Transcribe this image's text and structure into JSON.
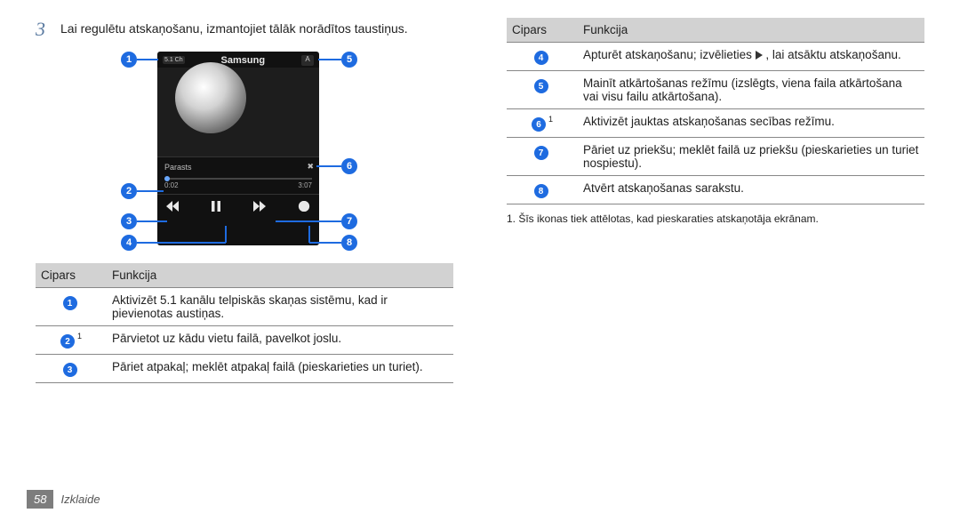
{
  "step": {
    "num": "3",
    "text": "Lai regulētu atskaņošanu, izmantojiet tālāk norādītos taustiņus."
  },
  "phone": {
    "btn51": "5.1 Ch",
    "title": "Samsung",
    "a": "A",
    "mode": "Parasts",
    "shuffle_glyph": "✖",
    "t0": "0:02",
    "t1": "3:07",
    "list_glyph": "≡"
  },
  "callouts": {
    "c1": "1",
    "c2": "2",
    "c3": "3",
    "c4": "4",
    "c5": "5",
    "c6": "6",
    "c7": "7",
    "c8": "8"
  },
  "left_table": {
    "h1": "Cipars",
    "h2": "Funkcija",
    "rows": [
      {
        "n": "1",
        "sup": "",
        "t": "Aktivizēt 5.1 kanālu telpiskās skaņas sistēmu, kad ir pievienotas austiņas."
      },
      {
        "n": "2",
        "sup": "1",
        "t": "Pārvietot uz kādu vietu failā, pavelkot joslu."
      },
      {
        "n": "3",
        "sup": "",
        "t": "Pāriet atpakaļ; meklēt atpakaļ failā (pieskarieties un turiet)."
      }
    ]
  },
  "right_table": {
    "h1": "Cipars",
    "h2": "Funkcija",
    "rows": [
      {
        "n": "4",
        "sup": "",
        "t_pre": "Apturēt atskaņošanu; izvēlieties ",
        "t_post": " , lai atsāktu atskaņošanu."
      },
      {
        "n": "5",
        "sup": "",
        "t": "Mainīt atkārtošanas režīmu (izslēgts, viena faila atkārtošana vai visu failu atkārtošana)."
      },
      {
        "n": "6",
        "sup": "1",
        "t": "Aktivizēt jauktas atskaņošanas secības režīmu."
      },
      {
        "n": "7",
        "sup": "",
        "t": "Pāriet uz priekšu; meklēt failā uz priekšu (pieskarieties un turiet nospiestu)."
      },
      {
        "n": "8",
        "sup": "",
        "t": "Atvērt atskaņošanas sarakstu."
      }
    ]
  },
  "footnote": "1. Šīs ikonas tiek attēlotas, kad pieskaraties atskaņotāja ekrānam.",
  "footer": {
    "page": "58",
    "section": "Izklaide"
  }
}
